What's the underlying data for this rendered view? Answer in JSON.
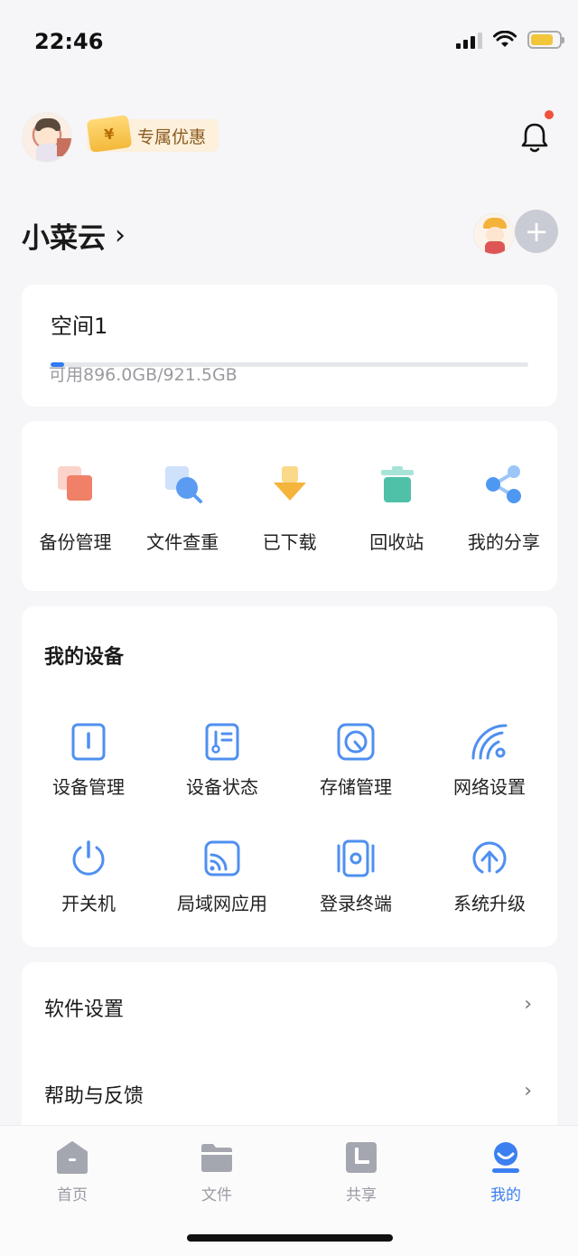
{
  "status_bar": {
    "time": "22:46",
    "battery_level": 0.8
  },
  "header": {
    "promo_ticket_symbol": "¥",
    "promo_label": "专属优惠",
    "has_notification": true
  },
  "space_header": {
    "title": "小菜云",
    "chevron": "›",
    "add_symbol": "+"
  },
  "storage": {
    "name": "空间1",
    "used_fraction": 0.028,
    "available_text": "可用896.0GB/921.5GB"
  },
  "tools": [
    {
      "label": "备份管理",
      "icon": "backup-icon"
    },
    {
      "label": "文件查重",
      "icon": "duplicate-search-icon"
    },
    {
      "label": "已下载",
      "icon": "download-icon"
    },
    {
      "label": "回收站",
      "icon": "trash-icon"
    },
    {
      "label": "我的分享",
      "icon": "share-icon"
    }
  ],
  "devices": {
    "title": "我的设备",
    "items": [
      {
        "label": "设备管理",
        "icon": "device-manage-icon"
      },
      {
        "label": "设备状态",
        "icon": "device-status-icon"
      },
      {
        "label": "存储管理",
        "icon": "storage-manage-icon"
      },
      {
        "label": "网络设置",
        "icon": "network-icon"
      },
      {
        "label": "开关机",
        "icon": "power-icon"
      },
      {
        "label": "局域网应用",
        "icon": "lan-app-icon"
      },
      {
        "label": "登录终端",
        "icon": "login-terminal-icon"
      },
      {
        "label": "系统升级",
        "icon": "upgrade-icon"
      }
    ]
  },
  "menu": [
    {
      "label": "软件设置",
      "chevron": "›"
    },
    {
      "label": "帮助与反馈",
      "chevron": "›"
    }
  ],
  "tabbar": {
    "tabs": [
      {
        "label": "首页",
        "icon": "home-icon",
        "active": false
      },
      {
        "label": "文件",
        "icon": "folder-icon",
        "active": false
      },
      {
        "label": "共享",
        "icon": "shared-icon",
        "active": false
      },
      {
        "label": "我的",
        "icon": "profile-icon",
        "active": true
      }
    ]
  },
  "colors": {
    "accent": "#3b7ff0",
    "device_icon": "#4f8ff0",
    "inactive_tab": "#a4a7b0",
    "notification_dot": "#f0523c",
    "background": "#f6f6f8"
  }
}
